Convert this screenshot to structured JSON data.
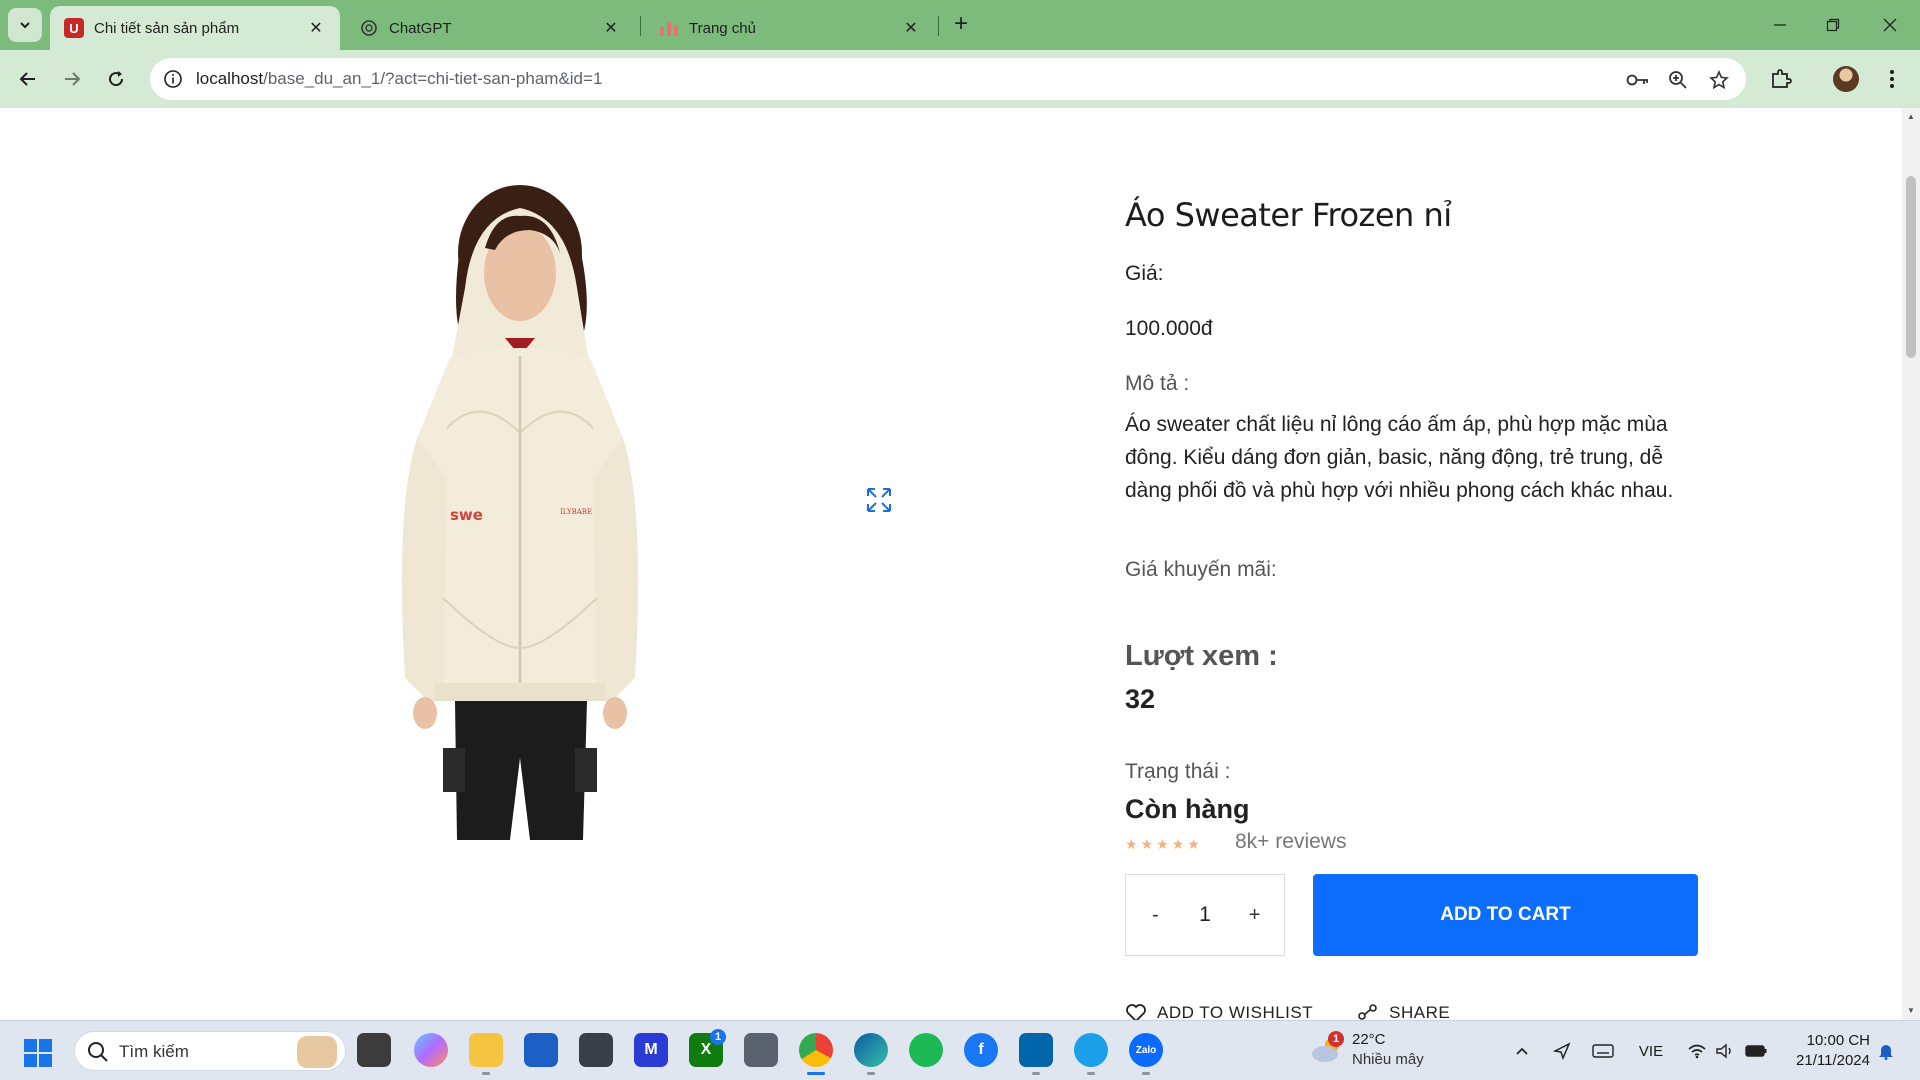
{
  "browser": {
    "tabs": [
      {
        "title": "Chi tiết sản sản phẩm",
        "favicon": "U",
        "favicon_color": "#c62828",
        "active": true
      },
      {
        "title": "ChatGPT",
        "favicon": "openai-icon",
        "active": false
      },
      {
        "title": "Trang chủ",
        "favicon": "chart-icon",
        "active": false
      }
    ],
    "url_host": "localhost",
    "url_path": "/base_du_an_1/?act=chi-tiet-san-pham&id=1"
  },
  "product": {
    "title": "Áo Sweater Frozen nỉ",
    "price_label": "Giá:",
    "price": "100.000đ",
    "desc_label": "Mô tả :",
    "description": "Áo sweater chất liệu nỉ lông cáo ấm áp, phù hợp mặc mùa đông. Kiểu dáng đơn giản, basic, năng động, trẻ trung, dễ dàng phối đồ và phù hợp với nhiều phong cách khác nhau.",
    "promo_label": "Giá khuyến mãi:",
    "views_label": "Lượt xem :",
    "views": "32",
    "status_label": "Trạng thái :",
    "status": "Còn hàng",
    "rating": 5,
    "reviews": "8k+ reviews",
    "qty_minus": "-",
    "qty": "1",
    "qty_plus": "+",
    "add_to_cart": "ADD TO CART",
    "wishlist": "ADD TO WISHLIST",
    "share": "SHARE"
  },
  "taskbar": {
    "search_placeholder": "Tìm kiếm",
    "weather_temp": "22°C",
    "weather_cond": "Nhiều mây",
    "weather_badge": "1",
    "xbox_badge": "1",
    "language": "VIE",
    "time": "10:00 CH",
    "date": "21/11/2024"
  },
  "colors": {
    "accent": "#0d6efd",
    "tabstrip": "#7dbb7d",
    "toolbar": "#d4ead4",
    "stars": "#f6b17a"
  }
}
